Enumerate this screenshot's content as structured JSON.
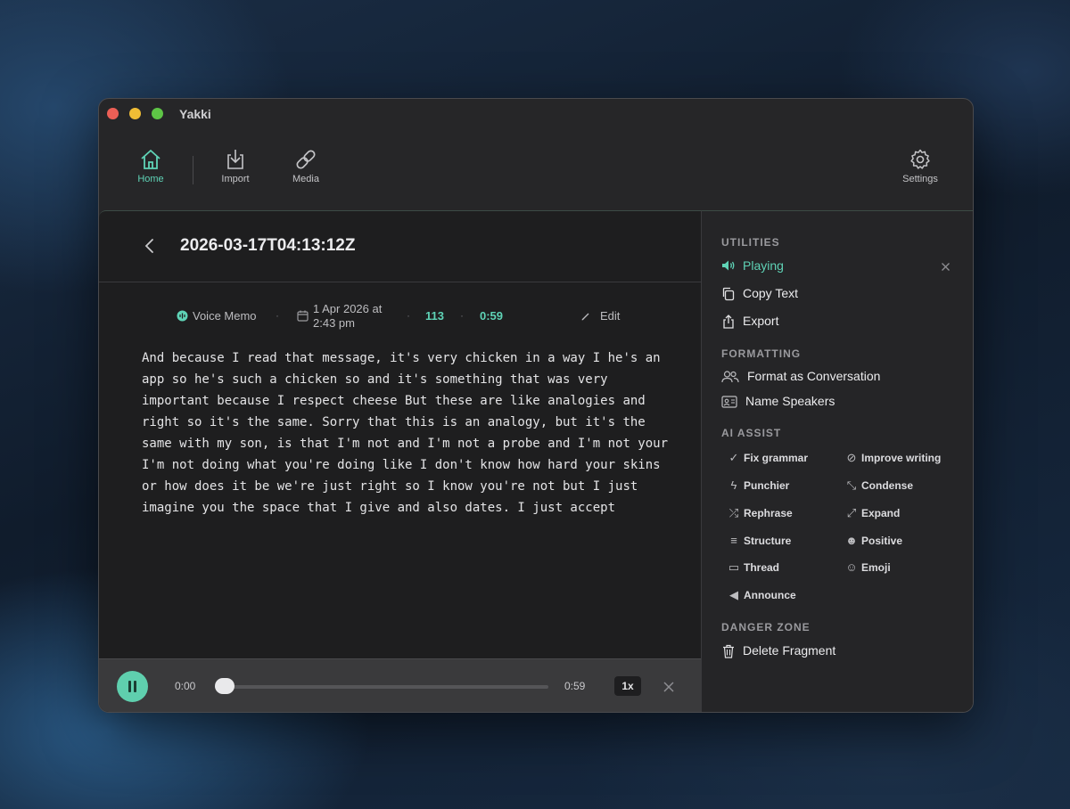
{
  "app": {
    "title": "Yakki"
  },
  "toolbar": {
    "home": "Home",
    "import": "Import",
    "media": "Media",
    "settings": "Settings"
  },
  "document": {
    "title": "2026-03-17T04:13:12Z",
    "type": "Voice Memo",
    "date_line1": "1 Apr 2026 at",
    "date_line2": "2:43 pm",
    "word_count": "113",
    "duration": "0:59",
    "edit": "Edit",
    "transcript": "And because I read that message, it's very chicken in a way I he's an app so he's such a chicken so and it's something that was very important because I respect cheese But these are like analogies and right so it's the same. Sorry that this is an analogy, but it's the same with my son, is that I'm not and I'm not a probe and I'm not your I'm not doing what you're doing like I don't know how hard your skins or how does it be we're just right so I know you're not but I just imagine you the space that I give and also dates. I just accept"
  },
  "player": {
    "current_time": "0:00",
    "total_time": "0:59",
    "speed": "1x",
    "progress": 0
  },
  "sidebar": {
    "utilities": {
      "title": "UTILITIES",
      "playing": "Playing",
      "copy_text": "Copy Text",
      "export": "Export"
    },
    "formatting": {
      "title": "FORMATTING",
      "format_conversation": "Format as Conversation",
      "name_speakers": "Name Speakers"
    },
    "ai_assist": {
      "title": "AI ASSIST",
      "fix_grammar": "Fix grammar",
      "improve_writing": "Improve writing",
      "punchier": "Punchier",
      "condense": "Condense",
      "rephrase": "Rephrase",
      "expand": "Expand",
      "structure": "Structure",
      "positive": "Positive",
      "thread": "Thread",
      "emoji": "Emoji",
      "announce": "Announce"
    },
    "danger": {
      "title": "DANGER ZONE",
      "delete": "Delete Fragment"
    }
  },
  "colors": {
    "accent": "#5fd3b6",
    "window_bg": "#262628",
    "content_bg": "#1e1e1f"
  }
}
